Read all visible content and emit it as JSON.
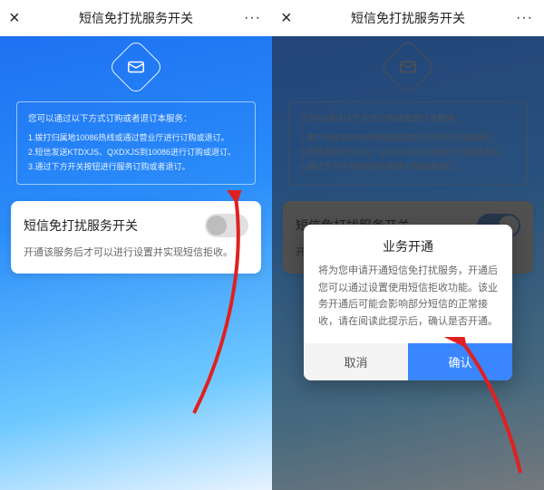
{
  "header": {
    "title": "短信免打扰服务开关",
    "close": "×",
    "more": "···"
  },
  "info": {
    "lead": "您可以通过以下方式订购或者退订本服务：",
    "line1": "1.拨打归属地10086热线或通过营业厅进行订购或退订。",
    "line2": "2.短信发送KTDXJS、QXDXJS到10086进行订购或退订。",
    "line3": "3.通过下方开关按钮进行服务订购或者退订。"
  },
  "card": {
    "title": "短信免打扰服务开关",
    "desc": "开通该服务后才可以进行设置并实现短信拒收。"
  },
  "dialog": {
    "title": "业务开通",
    "body": "将为您申请开通短信免打扰服务，开通后您可以通过设置使用短信拒收功能。该业务开通后可能会影响部分短信的正常接收，请在阅读此提示后，确认是否开通。",
    "cancel": "取消",
    "ok": "确认"
  }
}
